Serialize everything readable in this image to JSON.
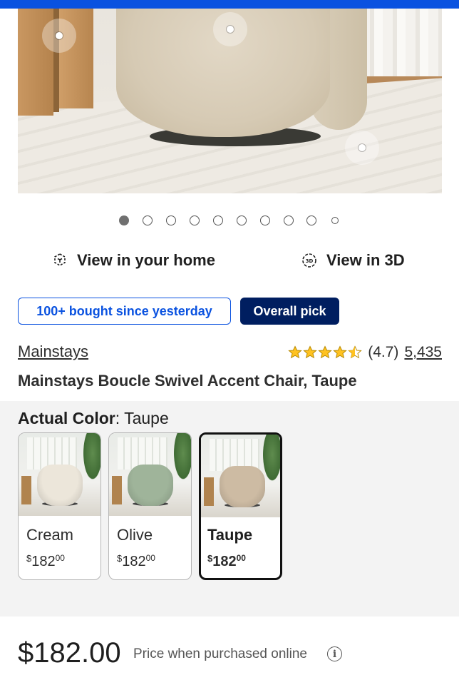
{
  "colors": {
    "brand_blue": "#0a52e0",
    "navy": "#001e60",
    "star": "#ffc220"
  },
  "gallery": {
    "image_count": 10,
    "active_index": 0,
    "hotspot_icon": "hotspot-dot-icon"
  },
  "actions": {
    "view_home": {
      "label": "View in your home",
      "icon": "ar-cube-icon"
    },
    "view_3d": {
      "label": "View in 3D",
      "icon": "3d-rotate-icon"
    }
  },
  "badges": {
    "bought": "100+ bought since yesterday",
    "pick": "Overall pick"
  },
  "product": {
    "brand": "Mainstays",
    "rating": "(4.7)",
    "rating_value": 4.7,
    "review_count": "5,435",
    "title": "Mainstays Boucle Swivel Accent Chair, Taupe"
  },
  "color_selector": {
    "heading_label": "Actual Color",
    "heading_value": ": Taupe",
    "options": [
      {
        "name": "Cream",
        "price_dollars": "182",
        "price_cents": "00",
        "chair_color": "#ece6da",
        "selected": false
      },
      {
        "name": "Olive",
        "price_dollars": "182",
        "price_cents": "00",
        "chair_color": "#9fb49a",
        "selected": false
      },
      {
        "name": "Taupe",
        "price_dollars": "182",
        "price_cents": "00",
        "chair_color": "#cdbba3",
        "selected": true
      }
    ]
  },
  "price": {
    "amount": "$182.00",
    "note": "Price when purchased online",
    "info_icon": "info-icon"
  }
}
